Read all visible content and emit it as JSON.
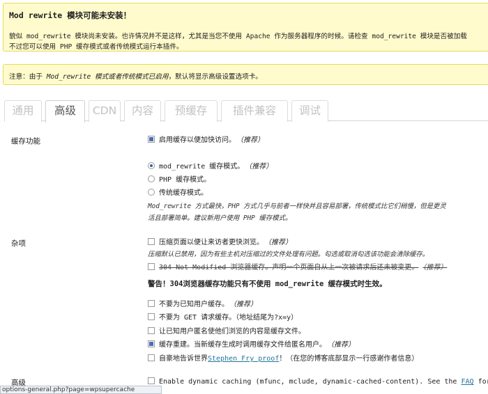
{
  "notice1": {
    "title": "Mod rewrite 模块可能未安装！",
    "line1": "貌似 mod_rewrite 模块尚未安装。也许情况并不是这样，尤其是当您不使用 Apache 作为服务器程序的时候。请检查 mod_rewrite 模块是否被加载",
    "line2": "不过您可以使用 PHP 缓存模式或者传统模式运行本插件。"
  },
  "notice2": {
    "prefix": "注意：由于 ",
    "italic": "Mod_rewrite 模式或者传统模式已启用",
    "suffix": "，默认将显示高级设置选项卡。"
  },
  "tabs": [
    "通用",
    "高级",
    "CDN",
    "内容",
    "预缓存",
    "插件兼容",
    "调试"
  ],
  "sections": {
    "caching": {
      "label": "缓存功能",
      "enable": "启用缓存以便加快访问。",
      "enable_rec": "（推荐）",
      "modes": [
        {
          "text": "mod_rewrite 缓存模式。",
          "rec": "（推荐）",
          "checked": true
        },
        {
          "text": "PHP 缓存模式。",
          "rec": "",
          "checked": false
        },
        {
          "text": "传统缓存模式。",
          "rec": "",
          "checked": false
        }
      ],
      "note1": "Mod_rewrite 方式最快，PHP 方式几乎与前者一样快并且容易部署，传统模式比它们稍慢，但是更灵",
      "note2": "活且部署简单。建议新用户使用 PHP 缓存模式。"
    },
    "misc": {
      "label": "杂项",
      "compress": "压缩页面以便让来访者更快浏览。",
      "compress_rec": "（推荐）",
      "compress_note": "压缩默认已禁用，因为有些主机对压缩过的文件处理有问题。勾选或取消勾选该功能会清除缓存。",
      "not_modified": "304 Not Modified 浏览器缓存。声明一个页面自从上一次被请求后还未被变更。",
      "not_modified_rec": "（推荐）",
      "warning": "警告！304浏览器缓存功能只有不使用 mod_rewrite 缓存模式时生效。",
      "options": [
        {
          "text": "不要为已知用户缓存。",
          "rec": "（推荐）",
          "checked": false
        },
        {
          "text": "不要为 GET 请求缓存。（地址结尾为?x=y）",
          "rec": "",
          "checked": false
        },
        {
          "text": "让已知用户匿名使他们浏览的内容是缓存文件。",
          "rec": "",
          "checked": false
        },
        {
          "text": "缓存重建。当新缓存生成时调用缓存文件给匿名用户。",
          "rec": "（推荐）",
          "checked": true
        }
      ],
      "credit_pre": "自豪地告诉世界",
      "credit_link": "Stephen Fry proof",
      "credit_post": "！（在您的博客底部显示一行感谢作者信息）"
    },
    "advanced": {
      "label": "高级",
      "dynamic_pre": "Enable dynamic caching (mfunc, mclude, dynamic-cached-content). See the ",
      "dynamic_link": "FAQ",
      "dynamic_post": " for"
    }
  },
  "statusbar": "options-general.php?page=wpsupercache"
}
